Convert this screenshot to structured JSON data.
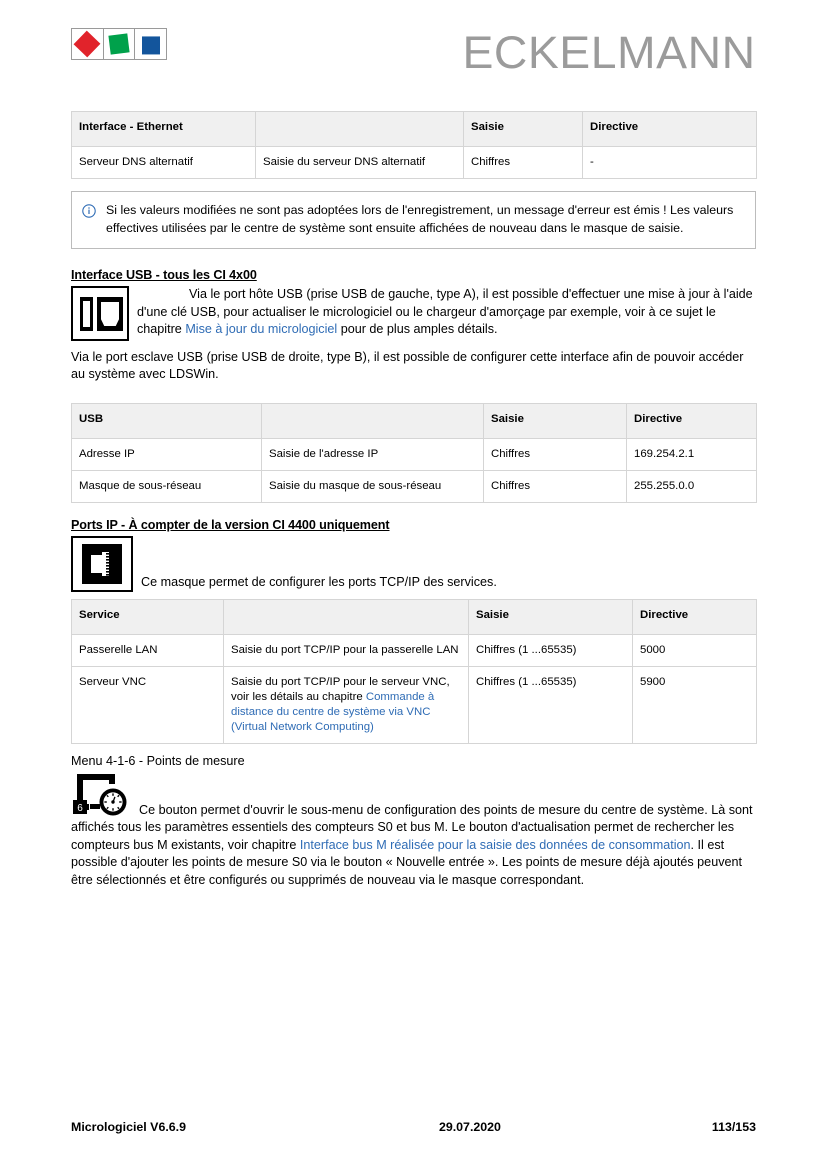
{
  "header": {
    "wordmark": "ECKELMANN",
    "logo_colors": {
      "red": "#e1232b",
      "green": "#00a14b",
      "blue": "#13559c"
    }
  },
  "ethernet_table": {
    "headers": [
      "Interface - Ethernet",
      "",
      "Saisie",
      "Directive"
    ],
    "rows": [
      [
        "Serveur DNS alternatif",
        "Saisie du serveur DNS alternatif",
        "Chiffres",
        "-"
      ]
    ]
  },
  "note": {
    "icon": "info-circle-icon",
    "text": "Si les valeurs modifiées ne sont pas adoptées lors de l'enregistrement, un message d'erreur est émis ! Les valeurs effectives utilisées par le centre de système sont ensuite affichées de nouveau dans le masque de saisie."
  },
  "usb_section": {
    "heading": "Interface USB - tous les CI 4x00",
    "icon": "usb-ports-icon",
    "para1_a": "Via le port hôte USB (prise USB de gauche, type A), il est possible d'effectuer une mise à jour à l'aide d'une clé USB, pour actualiser le micrologiciel ou le chargeur d'amorçage par exemple, voir à ce sujet le chapitre ",
    "para1_link": "Mise à jour du micrologiciel",
    "para1_b": "  pour de plus amples détails.",
    "para2": "Via le port esclave USB (prise USB de droite, type B), il est possible de configurer cette interface afin de pouvoir accéder au système avec LDSWin.",
    "table": {
      "headers": [
        "USB",
        "",
        "Saisie",
        "Directive"
      ],
      "rows": [
        [
          "Adresse IP",
          "Saisie de l'adresse IP",
          "Chiffres",
          "169.254.2.1"
        ],
        [
          "Masque de sous-réseau",
          "Saisie du masque de sous-réseau",
          "Chiffres",
          "255.255.0.0"
        ]
      ]
    }
  },
  "ports_section": {
    "heading": "Ports IP - À compter de la version CI 4400 uniquement",
    "icon": "rj45-port-icon",
    "intro": "Ce masque permet de configurer les ports TCP/IP des services.",
    "table": {
      "headers": [
        "Service",
        "",
        "Saisie",
        "Directive"
      ],
      "rows": [
        {
          "service": "Passerelle LAN",
          "description_a": "Saisie du port TCP/IP pour la passerelle LAN",
          "description_link": "",
          "saisie": "Chiffres (1 ...65535)",
          "directive": "5000"
        },
        {
          "service": "Serveur VNC",
          "description_a": "Saisie du port TCP/IP pour le serveur VNC, voir les détails au chapitre ",
          "description_link": "Commande à distance du centre de système via VNC (Virtual Network Computing)",
          "saisie": "Chiffres (1 ...65535)",
          "directive": "5900"
        }
      ]
    }
  },
  "measure_section": {
    "heading": "Menu 4-1-6 - Points de mesure",
    "icon": "measuring-points-gauge-icon",
    "icon_badge": "6",
    "para_a": "Ce bouton permet d'ouvrir le sous-menu de configuration des points de mesure du centre de système. Là sont affichés tous les paramètres essentiels des compteurs S0 et bus M. Le bouton d'actualisation permet de rechercher les compteurs bus M existants, voir chapitre ",
    "para_link": "Interface bus M réalisée pour la saisie des données de consommation",
    "para_b": ". Il est possible d'ajouter les points de mesure S0 via le bouton « Nouvelle entrée ». Les points de mesure déjà ajoutés peuvent être sélectionnés et être configurés ou supprimés de nouveau via le masque correspondant."
  },
  "footer": {
    "left": "Micrologiciel V6.6.9",
    "center": "29.07.2020",
    "right": "113/153"
  }
}
